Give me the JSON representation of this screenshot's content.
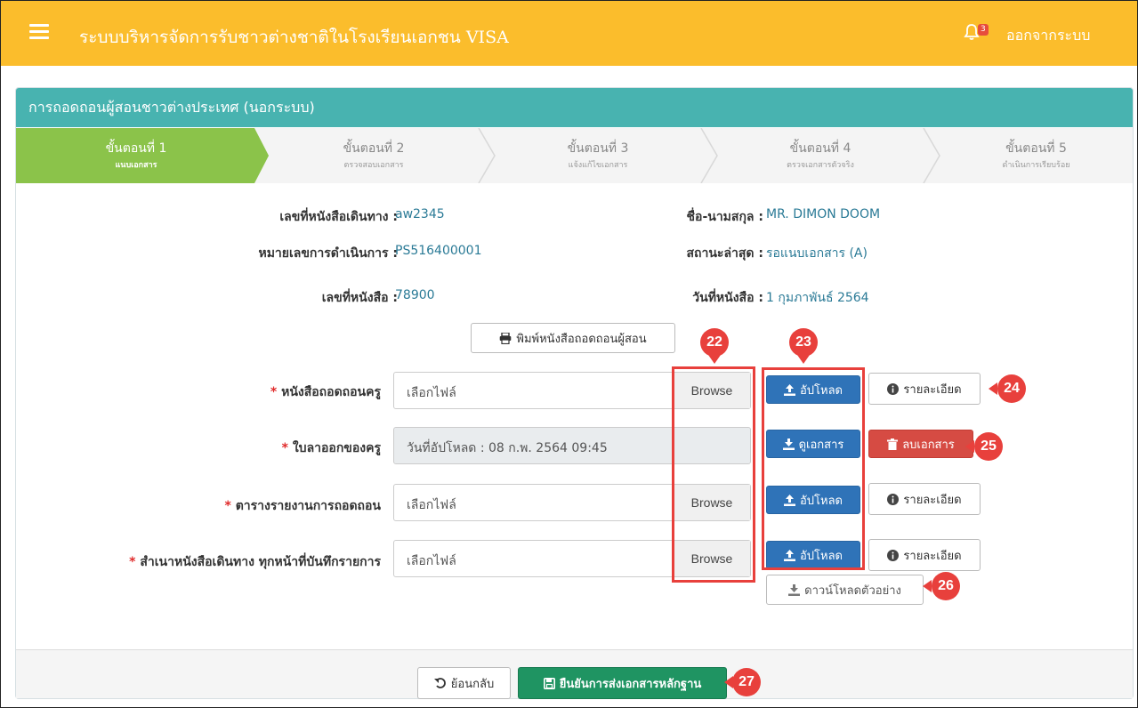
{
  "header": {
    "title": "ระบบบริหารจัดการรับชาวต่างชาติในโรงเรียนเอกชน VISA",
    "notification_count": "3",
    "logout_label": "ออกจากระบบ"
  },
  "panel": {
    "title": "การถอดถอนผู้สอนชาวต่างประเทศ (นอกระบบ)"
  },
  "steps": [
    {
      "title": "ขั้นตอนที่ 1",
      "subtitle": "แนบเอกสาร",
      "active": true
    },
    {
      "title": "ขั้นตอนที่ 2",
      "subtitle": "ตรวจสอบเอกสาร",
      "active": false
    },
    {
      "title": "ขั้นตอนที่ 3",
      "subtitle": "แจ้งแก้ไขเอกสาร",
      "active": false
    },
    {
      "title": "ขั้นตอนที่ 4",
      "subtitle": "ตรวจเอกสารตัวจริง",
      "active": false
    },
    {
      "title": "ขั้นตอนที่ 5",
      "subtitle": "ดำเนินการเรียบร้อย",
      "active": false
    }
  ],
  "info": {
    "passport_label": "เลขที่หนังสือเดินทาง :",
    "passport_value": "aw2345",
    "name_label": "ชื่อ-นามสกุล :",
    "name_value": "MR. DIMON DOOM",
    "operation_label": "หมายเลขการดำเนินการ :",
    "operation_value": "PS516400001",
    "status_label": "สถานะล่าสุด :",
    "status_value": "รอแนบเอกสาร (A)",
    "doc_no_label": "เลขที่หนังสือ :",
    "doc_no_value": "78900",
    "doc_date_label": "วันที่หนังสือ :",
    "doc_date_value": "1 กุมภาพันธ์ 2564"
  },
  "print_button": "พิมพ์หนังสือถอดถอนผู้สอน",
  "documents": [
    {
      "required": "*",
      "label": "หนังสือถอดถอนครู",
      "file_text": "เลือกไฟล์",
      "browse": "Browse",
      "action": "อัปโหลด",
      "secondary": "รายละเอียด"
    },
    {
      "required": "*",
      "label": "ใบลาออกของครู",
      "file_text": "วันที่อัปโหลด  :  08 ก.พ. 2564 09:45",
      "action": "ดูเอกสาร",
      "secondary": "ลบเอกสาร"
    },
    {
      "required": "*",
      "label": "ตารางรายงานการถอดถอน",
      "file_text": "เลือกไฟล์",
      "browse": "Browse",
      "action": "อัปโหลด",
      "secondary": "รายละเอียด"
    },
    {
      "required": "*",
      "label": "สำเนาหนังสือเดินทาง ทุกหน้าที่บันทึกรายการ",
      "file_text": "เลือกไฟล์",
      "browse": "Browse",
      "action": "อัปโหลด",
      "secondary": "รายละเอียด"
    }
  ],
  "download_sample": "ดาวน์โหลดตัวอย่าง",
  "footer": {
    "back": "ย้อนกลับ",
    "confirm": "ยืนยันการส่งเอกสารหลักฐาน"
  },
  "callouts": [
    "22",
    "23",
    "24",
    "25",
    "26",
    "27"
  ],
  "colors": {
    "topbar": "#fbbd2c",
    "panel_header": "#48b3b0",
    "step_active": "#8bc34a",
    "primary": "#2f73b8",
    "danger": "#d64b43",
    "success": "#1f9462",
    "callout": "#e8403c"
  }
}
